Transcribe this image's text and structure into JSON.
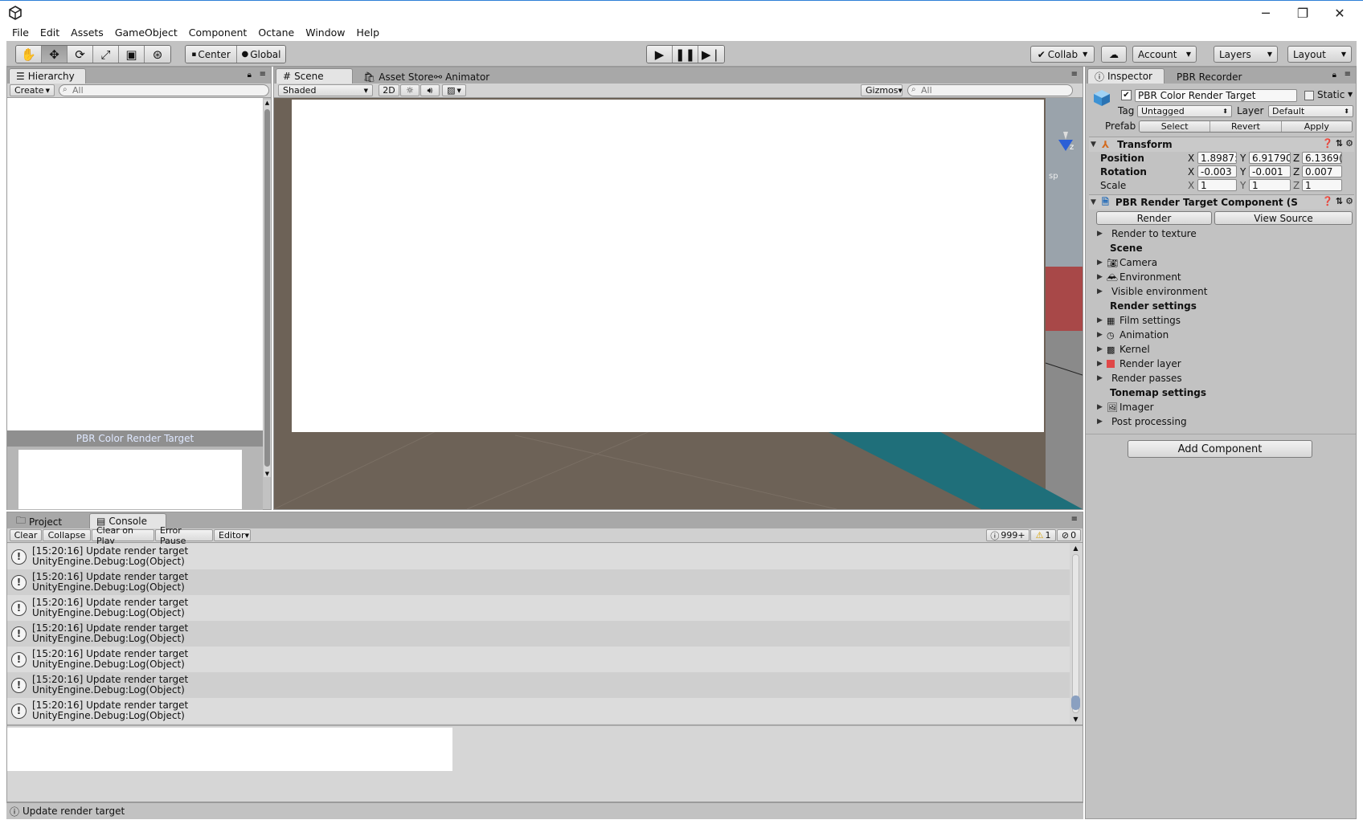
{
  "window": {
    "minimize": "─",
    "restore": "❐",
    "close": "✕"
  },
  "menu": [
    "File",
    "Edit",
    "Assets",
    "GameObject",
    "Component",
    "Octane",
    "Window",
    "Help"
  ],
  "toolbar": {
    "pivot": "Center",
    "space": "Global",
    "collab": "Collab",
    "account": "Account",
    "layers": "Layers",
    "layout": "Layout"
  },
  "hierarchy": {
    "tab": "Hierarchy",
    "create": "Create",
    "search_placeholder": "All",
    "preview_title": "PBR Color Render Target"
  },
  "scene": {
    "tabs": [
      "Scene",
      "Asset Store",
      "Animator"
    ],
    "shading": "Shaded",
    "mode2d": "2D",
    "gizmos": "Gizmos",
    "search_placeholder": "All",
    "axis_label": "z",
    "persp": "sp"
  },
  "console": {
    "tabs": [
      "Project",
      "Console"
    ],
    "buttons": [
      "Clear",
      "Collapse",
      "Clear on Play",
      "Error Pause"
    ],
    "editor": "Editor",
    "counts": {
      "log": "999+",
      "warn": "1",
      "error": "0"
    },
    "entries": [
      {
        "line1": "[15:20:16] Update render target",
        "line2": "UnityEngine.Debug:Log(Object)"
      },
      {
        "line1": "[15:20:16] Update render target",
        "line2": "UnityEngine.Debug:Log(Object)"
      },
      {
        "line1": "[15:20:16] Update render target",
        "line2": "UnityEngine.Debug:Log(Object)"
      },
      {
        "line1": "[15:20:16] Update render target",
        "line2": "UnityEngine.Debug:Log(Object)"
      },
      {
        "line1": "[15:20:16] Update render target",
        "line2": "UnityEngine.Debug:Log(Object)"
      },
      {
        "line1": "[15:20:16] Update render target",
        "line2": "UnityEngine.Debug:Log(Object)"
      },
      {
        "line1": "[15:20:16] Update render target",
        "line2": "UnityEngine.Debug:Log(Object)"
      }
    ]
  },
  "status": {
    "message": "Update render target"
  },
  "inspector": {
    "tabs": [
      "Inspector",
      "PBR Recorder"
    ],
    "object_name": "PBR Color Render Target",
    "static_label": "Static",
    "tag_label": "Tag",
    "tag_value": "Untagged",
    "layer_label": "Layer",
    "layer_value": "Default",
    "prefab_label": "Prefab",
    "prefab_buttons": [
      "Select",
      "Revert",
      "Apply"
    ],
    "transform": {
      "title": "Transform",
      "position_label": "Position",
      "position": [
        "1.8987:",
        "6.91790",
        "6.1369("
      ],
      "rotation_label": "Rotation",
      "rotation": [
        "-0.003",
        "-0.001",
        "0.007"
      ],
      "scale_label": "Scale",
      "scale": [
        "1",
        "1",
        "1"
      ],
      "axes": [
        "X",
        "Y",
        "Z"
      ]
    },
    "component": {
      "title": "PBR Render Target Component (S",
      "render_button": "Render",
      "view_source_button": "View Source",
      "items": [
        {
          "type": "fold",
          "label": "Render to texture"
        },
        {
          "type": "header",
          "label": "Scene"
        },
        {
          "type": "fold",
          "label": "Camera",
          "icon": "camera-icon"
        },
        {
          "type": "fold",
          "label": "Environment",
          "icon": "environment-icon"
        },
        {
          "type": "fold",
          "label": "Visible environment"
        },
        {
          "type": "header",
          "label": "Render settings"
        },
        {
          "type": "fold",
          "label": "Film settings",
          "icon": "film-icon"
        },
        {
          "type": "fold",
          "label": "Animation",
          "icon": "clock-icon"
        },
        {
          "type": "fold",
          "label": "Kernel",
          "icon": "kernel-icon"
        },
        {
          "type": "fold",
          "label": "Render layer",
          "icon": "layer-icon"
        },
        {
          "type": "fold",
          "label": "Render passes"
        },
        {
          "type": "header",
          "label": "Tonemap settings"
        },
        {
          "type": "fold",
          "label": "Imager",
          "icon": "image-icon"
        },
        {
          "type": "fold",
          "label": "Post processing"
        }
      ]
    },
    "add_component": "Add Component"
  },
  "colors": {
    "panel": "#c2c2c2",
    "accent": "#2f7fd6",
    "teal": "#1f6f7a"
  }
}
